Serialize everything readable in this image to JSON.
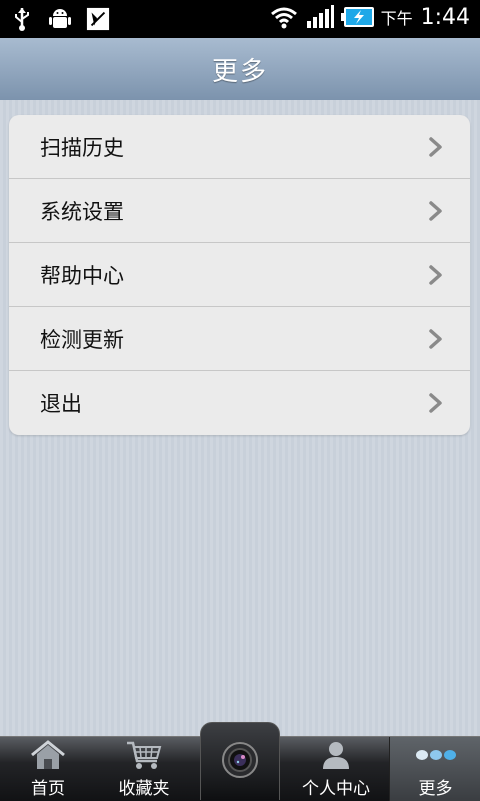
{
  "status_bar": {
    "ampm": "下午",
    "time": "1:44",
    "icons": [
      "usb-icon",
      "android-debug-icon",
      "no-sim-icon",
      "wifi-icon",
      "signal-icon",
      "battery-charging-icon"
    ]
  },
  "header": {
    "title": "更多"
  },
  "menu": {
    "items": [
      {
        "label": "扫描历史"
      },
      {
        "label": "系统设置"
      },
      {
        "label": "帮助中心"
      },
      {
        "label": "检测更新"
      },
      {
        "label": "退出"
      }
    ]
  },
  "tabbar": {
    "tabs": [
      {
        "label": "首页",
        "icon": "home-icon"
      },
      {
        "label": "收藏夹",
        "icon": "cart-icon"
      },
      {
        "label": "",
        "icon": "camera-icon"
      },
      {
        "label": "个人中心",
        "icon": "user-icon"
      },
      {
        "label": "更多",
        "icon": "more-dots-icon"
      }
    ],
    "active": "更多"
  },
  "colors": {
    "title_bar": "#8ea3bb",
    "menu_bg": "#ebebeb",
    "more_dots": "#4fb0e8"
  }
}
